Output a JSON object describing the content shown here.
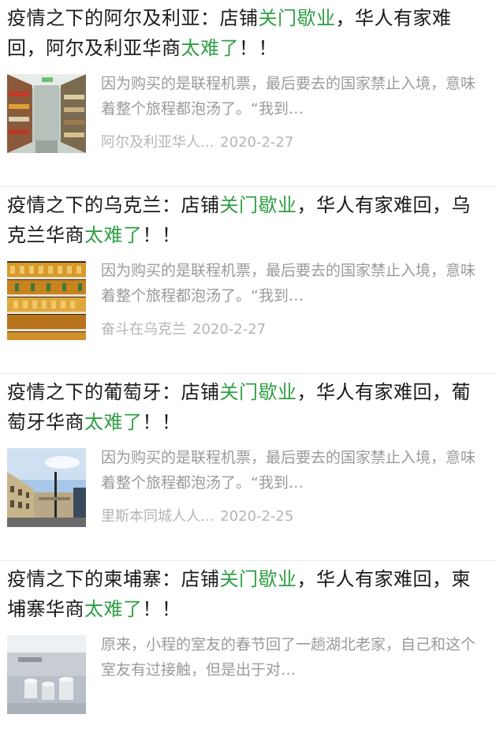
{
  "articles": [
    {
      "title_before": "疫情之下的阿尔及利亚：店铺",
      "title_hl1": "关门歇业",
      "title_middle": "，华人有家难回，阿尔及利亚华商",
      "title_hl2": "太难了",
      "title_after": "！！",
      "summary": "因为购买的是联程机票，最后要去的国家禁止入境，意味着整个旅程都泡汤了。“我到…",
      "source": "阿尔及利亚华人...",
      "date": "2020-2-27",
      "thumb": "grocery-aisle"
    },
    {
      "title_before": "疫情之下的乌克兰：店铺",
      "title_hl1": "关门歇业",
      "title_middle": "，华人有家难回，乌克兰华商",
      "title_hl2": "太难了",
      "title_after": "！！",
      "summary": "因为购买的是联程机票，最后要去的国家禁止入境，意味着整个旅程都泡汤了。“我到…",
      "source": "奋斗在乌克兰",
      "date": "2020-2-27",
      "thumb": "store-shelves"
    },
    {
      "title_before": "疫情之下的葡萄牙：店铺",
      "title_hl1": "关门歇业",
      "title_middle": "，华人有家难回，葡萄牙华商",
      "title_hl2": "太难了",
      "title_after": "！！",
      "summary": "因为购买的是联程机票，最后要去的国家禁止入境，意味着整个旅程都泡汤了。“我到…",
      "source": "里斯本同城人人...",
      "date": "2020-2-25",
      "thumb": "city-street"
    },
    {
      "title_before": "疫情之下的柬埔寨：店铺",
      "title_hl1": "关门歇业",
      "title_middle": "，华人有家难回，柬埔寨华商",
      "title_hl2": "太难了",
      "title_after": "！！",
      "summary": "原来，小程的室友的春节回了一趟湖北老家，自己和这个室友有过接触，但是出于对…",
      "source": "",
      "date": "",
      "thumb": "rooftop-buckets"
    }
  ],
  "colors": {
    "title": "#1a1a1a",
    "highlight": "#2f9e44",
    "summary": "#9a9a9a",
    "meta": "#b5b5b5"
  }
}
